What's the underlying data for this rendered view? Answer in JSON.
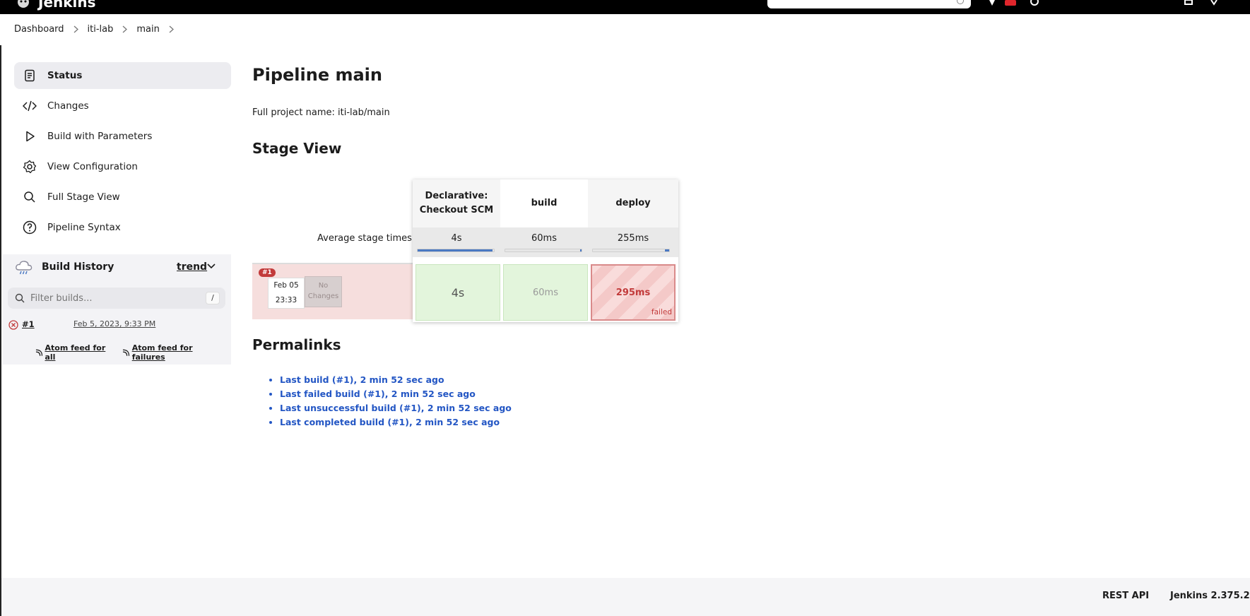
{
  "app": {
    "brand": "Jenkins"
  },
  "breadcrumb": [
    "Dashboard",
    "iti-lab",
    "main"
  ],
  "sidebar": {
    "items": [
      {
        "label": "Status",
        "icon": "status-icon"
      },
      {
        "label": "Changes",
        "icon": "code-icon"
      },
      {
        "label": "Build with Parameters",
        "icon": "play-icon"
      },
      {
        "label": "View Configuration",
        "icon": "gear-icon"
      },
      {
        "label": "Full Stage View",
        "icon": "search-icon"
      },
      {
        "label": "Pipeline Syntax",
        "icon": "help-icon"
      }
    ]
  },
  "build_history": {
    "title": "Build History",
    "trend_label": "trend",
    "filter_placeholder": "Filter builds...",
    "filter_shortcut": "/",
    "builds": [
      {
        "number": "#1",
        "date": "Feb 5, 2023, 9:33 PM",
        "status": "failed"
      }
    ],
    "feed_all": "Atom feed for all",
    "feed_failures": "Atom feed for failures"
  },
  "main": {
    "title": "Pipeline main",
    "full_name": "Full project name: iti-lab/main",
    "stage_view_title": "Stage View",
    "avg_label": "Average stage times:",
    "stages": [
      {
        "name_line1": "Declarative:",
        "name_line2": "Checkout SCM",
        "avg": "4s",
        "avg_fill": 0.98
      },
      {
        "name_line1": "build",
        "name_line2": "",
        "avg": "60ms",
        "avg_fill": 0.02
      },
      {
        "name_line1": "deploy",
        "name_line2": "",
        "avg": "255ms",
        "avg_fill": 0.06
      }
    ],
    "run": {
      "badge": "#1",
      "date": "Feb 05",
      "time": "23:33",
      "changes_line1": "No",
      "changes_line2": "Changes",
      "cells": [
        {
          "value": "4s",
          "status": "success"
        },
        {
          "value": "60ms",
          "status": "success"
        },
        {
          "value": "295ms",
          "status": "failed",
          "flag": "failed"
        }
      ]
    },
    "permalinks_title": "Permalinks",
    "permalinks": [
      "Last build (#1), 2 min 52 sec ago",
      "Last failed build (#1), 2 min 52 sec ago",
      "Last unsuccessful build (#1), 2 min 52 sec ago",
      "Last completed build (#1), 2 min 52 sec ago"
    ]
  },
  "footer": {
    "rest_api": "REST API",
    "version": "Jenkins 2.375.2"
  },
  "colors": {
    "failed": "#c23b3b",
    "success_bg": "#e3f5dc",
    "link": "#2356c4",
    "avg_bar": "#4a78c2"
  }
}
